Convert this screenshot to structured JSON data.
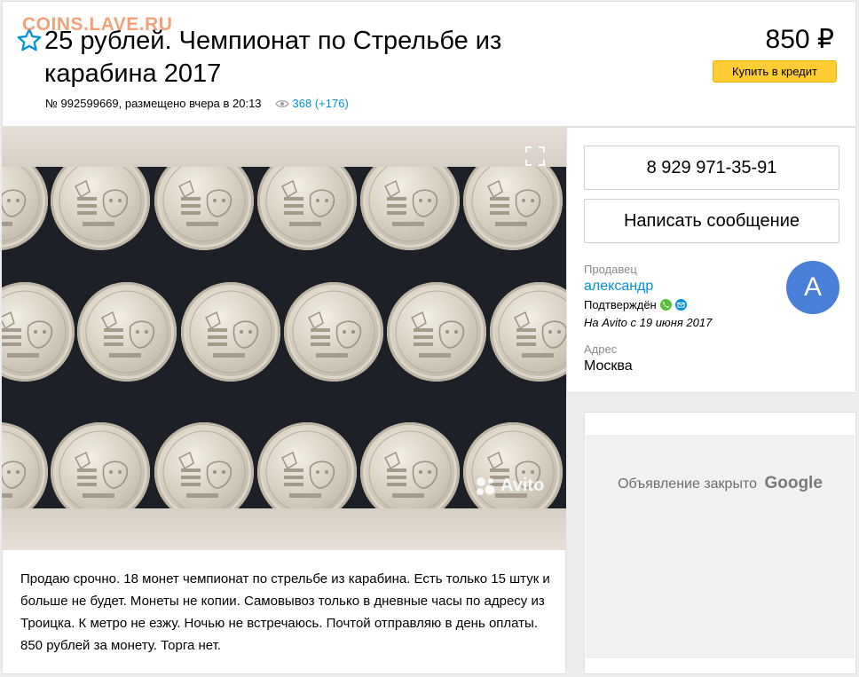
{
  "watermark": "COINS.LAVE.RU",
  "listing": {
    "title": "25 рублей. Чемпионат по Стрельбе из карабина 2017",
    "meta": "№ 992599669, размещено вчера в 20:13",
    "views": "368 (+176)",
    "price": "850 ₽",
    "credit_button": "Купить в кредит"
  },
  "photo": {
    "watermark_label": "Avito",
    "icons": {
      "fullscreen": "fullscreen-icon",
      "favorite": "star-icon",
      "views": "eye-icon"
    }
  },
  "description": "Продаю срочно. 18 монет чемпионат по стрельбе из карабина. Есть только 15 штук и больше не будет. Монеты не копии. Самовывоз только в дневные часы по адресу из Троицка. К метро не езжу. Ночью не встречаюсь. Почтой отправляю в день оплаты. 850 рублей за монету. Торга нет.",
  "contact": {
    "phone": "8 929 971-35-91",
    "message_button": "Написать сообщение",
    "seller_label": "Продавец",
    "seller_name": "александр",
    "verified": "Подтверждён",
    "since": "На Avito с 19 июня 2017",
    "avatar_letter": "А",
    "address_label": "Адрес",
    "address": "Москва"
  },
  "ad": {
    "closed_text": "Объявление закрыто",
    "brand": "Google"
  },
  "colors": {
    "link": "#0091d9",
    "credit_button": "#ffcc33",
    "avatar": "#4a7fd9",
    "watermark": "#f08a58"
  }
}
